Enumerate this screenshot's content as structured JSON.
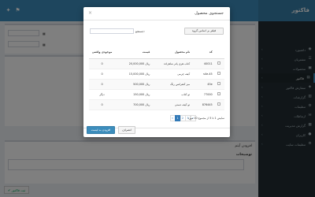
{
  "app": {
    "brand": "فاکتور",
    "sidebar": {
      "items": [
        {
          "label": "داشبورد",
          "icon": "dashboard-icon",
          "glyph": "◉"
        },
        {
          "label": "مشتریان",
          "icon": "users-icon",
          "glyph": "☰"
        },
        {
          "label": "محصولات",
          "icon": "box-icon",
          "glyph": "▣"
        },
        {
          "label": "فاکتور",
          "icon": "file-icon",
          "glyph": "▤",
          "active": true
        },
        {
          "label": "سفارش فاکتور",
          "icon": "cart-icon",
          "glyph": "◈"
        },
        {
          "label": "گزارشات",
          "icon": "chart-icon",
          "glyph": "▥"
        },
        {
          "label": "تنظیمات",
          "icon": "gear-icon",
          "glyph": "⚙"
        },
        {
          "label": "ارتباطات",
          "icon": "envelope-icon",
          "glyph": "✉"
        },
        {
          "label": "گزارش مدیریت",
          "icon": "report-icon",
          "glyph": "▦"
        },
        {
          "label": "کاربران",
          "icon": "user-icon",
          "glyph": "●"
        },
        {
          "label": "تنظیمات سایت",
          "icon": "cog-icon",
          "glyph": "⚙"
        }
      ]
    },
    "background": {
      "section_title": "افزودن آیتم",
      "notes_label": "توضیحات",
      "add_item_button": "ثبت فاکتور"
    }
  },
  "modal": {
    "title": "جستجوی محصول",
    "filter_button": "فیلتر بر اساس گروه",
    "search_label": "جستجو:",
    "search_value": "",
    "columns": {
      "code": "کد",
      "name": "نام محصول",
      "price": "قیمت",
      "stock": "موجودی واقعی"
    },
    "rows": [
      {
        "code": "40011",
        "name": "کتاب هری پاتر شاهزاده",
        "price": "20,000,000",
        "unit": "ریال",
        "stock": "0"
      },
      {
        "code": "s4e-45",
        "name": "کیف چرمی",
        "price": "15,000,000",
        "unit": "ریال",
        "stock": "0"
      },
      {
        "code": "45e",
        "name": "میز کنفرانس رنگ",
        "price": "500,000",
        "unit": "ریال",
        "stock": "0"
      },
      {
        "code": "77000",
        "name": "تو کتاب",
        "price": "150,000",
        "unit": "ریال",
        "stock": "دیگر"
      },
      {
        "code": "876445",
        "name": "تو کیف دستی",
        "price": "700,000",
        "unit": "ریال",
        "stock": "0"
      }
    ],
    "info_text": "نمایش 1 تا 5 از مجموع 10 مورد",
    "pagination": [
      {
        "label": "«"
      },
      {
        "label": "1",
        "active": true
      },
      {
        "label": "2"
      },
      {
        "label": "3"
      },
      {
        "label": "»"
      }
    ],
    "add_button": "افزودن به لیست",
    "cancel_button": "انصراف",
    "close_symbol": "×"
  }
}
